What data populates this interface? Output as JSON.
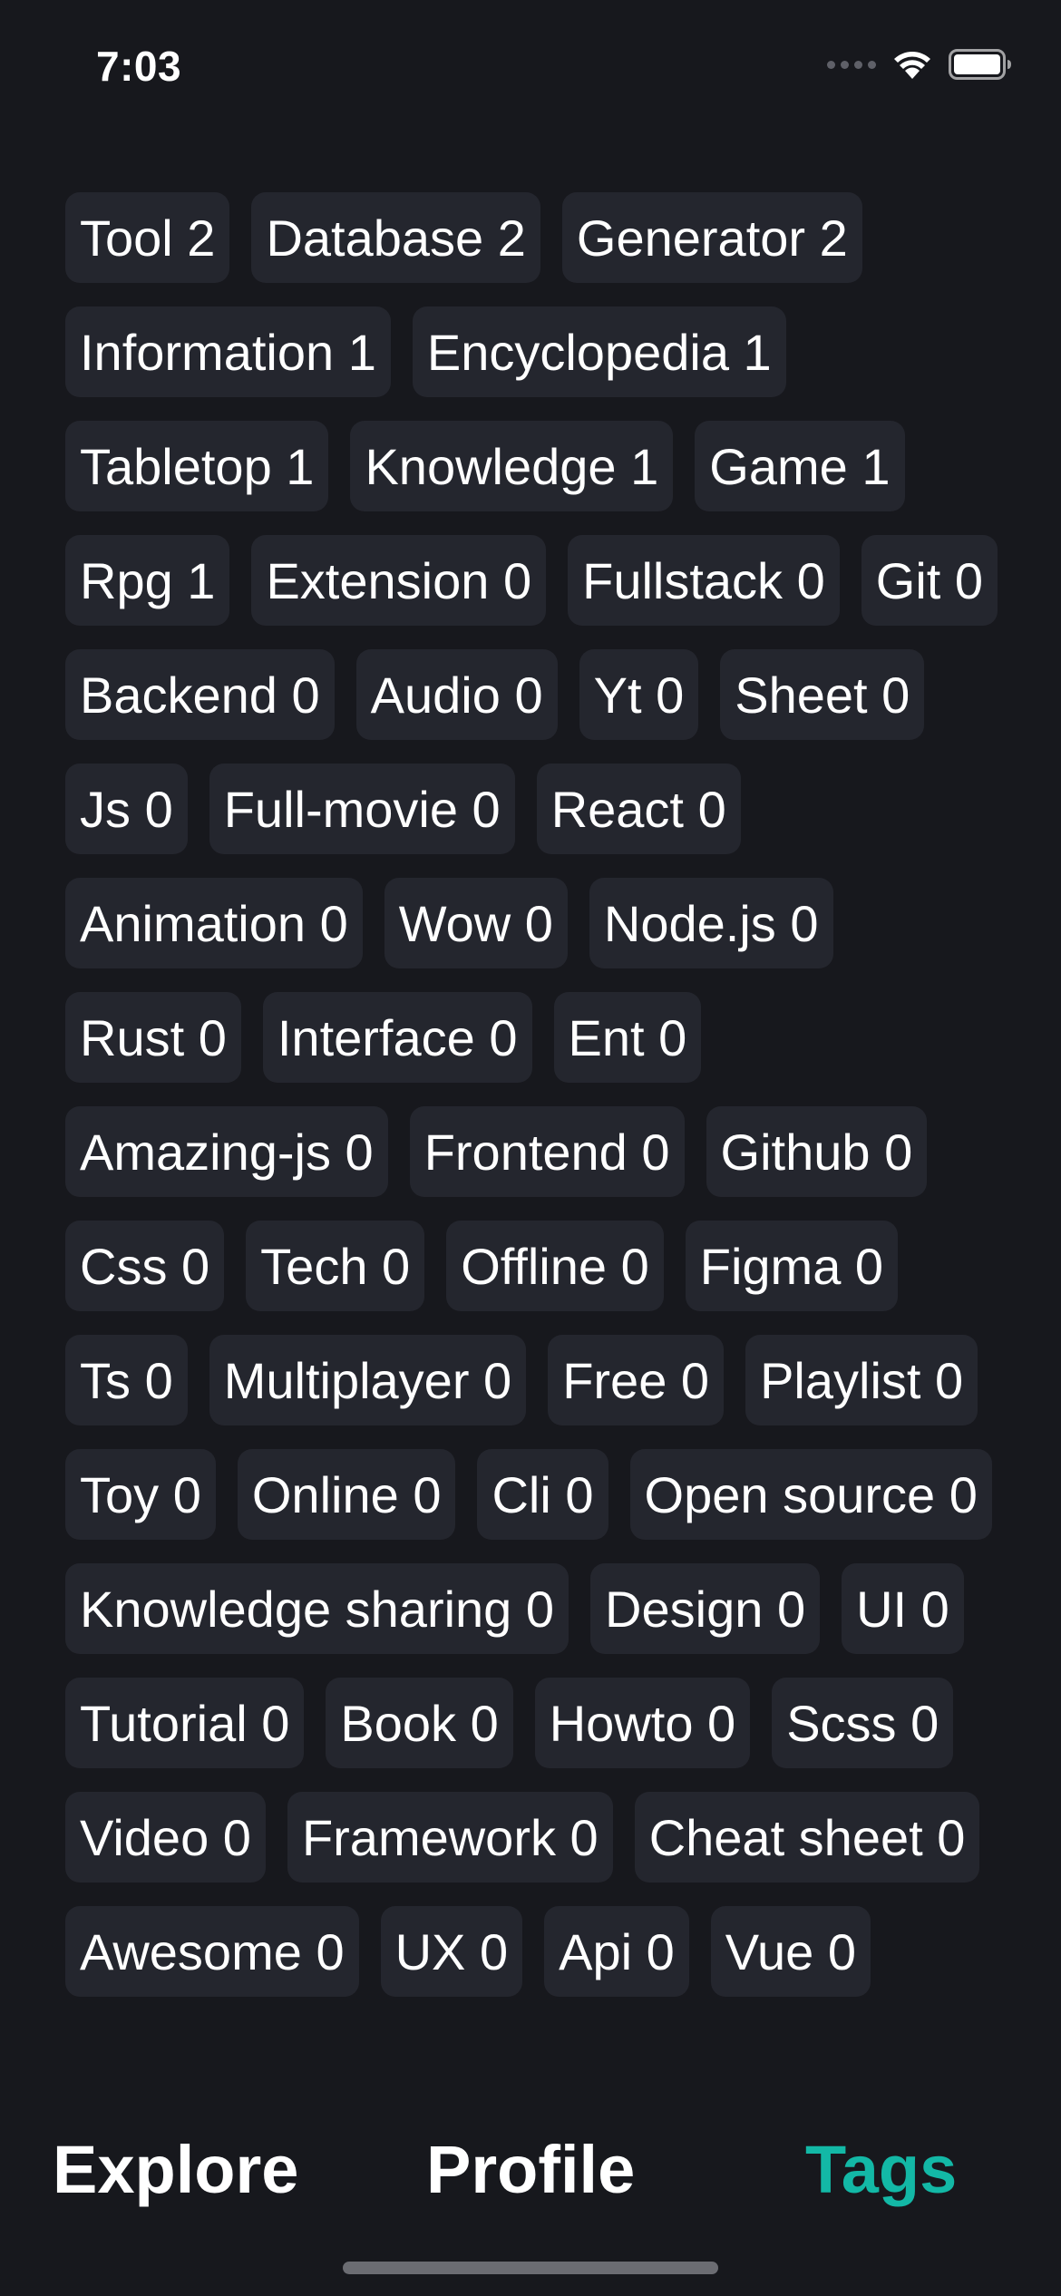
{
  "status_bar": {
    "time": "7:03",
    "icons": [
      "cellular-signal-icon",
      "wifi-icon",
      "battery-icon"
    ]
  },
  "colors": {
    "background": "#17181d",
    "tag_background": "#24262e",
    "text": "#ffffff",
    "accent": "#13b8a6"
  },
  "tags": [
    {
      "label": "Tool",
      "count": "2"
    },
    {
      "label": "Database",
      "count": "2"
    },
    {
      "label": "Generator",
      "count": "2"
    },
    {
      "label": "Information",
      "count": "1"
    },
    {
      "label": "Encyclopedia",
      "count": "1"
    },
    {
      "label": "Tabletop",
      "count": "1"
    },
    {
      "label": "Knowledge",
      "count": "1"
    },
    {
      "label": "Game",
      "count": "1"
    },
    {
      "label": "Rpg",
      "count": "1"
    },
    {
      "label": "Extension",
      "count": "0"
    },
    {
      "label": "Fullstack",
      "count": "0"
    },
    {
      "label": "Git",
      "count": "0"
    },
    {
      "label": "Backend",
      "count": "0"
    },
    {
      "label": "Audio",
      "count": "0"
    },
    {
      "label": "Yt",
      "count": "0"
    },
    {
      "label": "Sheet",
      "count": "0"
    },
    {
      "label": "Js",
      "count": "0"
    },
    {
      "label": "Full-movie",
      "count": "0"
    },
    {
      "label": "React",
      "count": "0"
    },
    {
      "label": "Animation",
      "count": "0"
    },
    {
      "label": "Wow",
      "count": "0"
    },
    {
      "label": "Node.js",
      "count": "0"
    },
    {
      "label": "Rust",
      "count": "0"
    },
    {
      "label": "Interface",
      "count": "0"
    },
    {
      "label": "Ent",
      "count": "0"
    },
    {
      "label": "Amazing-js",
      "count": "0"
    },
    {
      "label": "Frontend",
      "count": "0"
    },
    {
      "label": "Github",
      "count": "0"
    },
    {
      "label": "Css",
      "count": "0"
    },
    {
      "label": "Tech",
      "count": "0"
    },
    {
      "label": "Offline",
      "count": "0"
    },
    {
      "label": "Figma",
      "count": "0"
    },
    {
      "label": "Ts",
      "count": "0"
    },
    {
      "label": "Multiplayer",
      "count": "0"
    },
    {
      "label": "Free",
      "count": "0"
    },
    {
      "label": "Playlist",
      "count": "0"
    },
    {
      "label": "Toy",
      "count": "0"
    },
    {
      "label": "Online",
      "count": "0"
    },
    {
      "label": "Cli",
      "count": "0"
    },
    {
      "label": "Open source",
      "count": "0"
    },
    {
      "label": "Knowledge sharing",
      "count": "0"
    },
    {
      "label": "Design",
      "count": "0"
    },
    {
      "label": "UI",
      "count": "0"
    },
    {
      "label": "Tutorial",
      "count": "0"
    },
    {
      "label": "Book",
      "count": "0"
    },
    {
      "label": "Howto",
      "count": "0"
    },
    {
      "label": "Scss",
      "count": "0"
    },
    {
      "label": "Video",
      "count": "0"
    },
    {
      "label": "Framework",
      "count": "0"
    },
    {
      "label": "Cheat sheet",
      "count": "0"
    },
    {
      "label": "Awesome",
      "count": "0"
    },
    {
      "label": "UX",
      "count": "0"
    },
    {
      "label": "Api",
      "count": "0"
    },
    {
      "label": "Vue",
      "count": "0"
    }
  ],
  "tab_bar": {
    "explore": "Explore",
    "profile": "Profile",
    "tags": "Tags",
    "active": "tags"
  }
}
